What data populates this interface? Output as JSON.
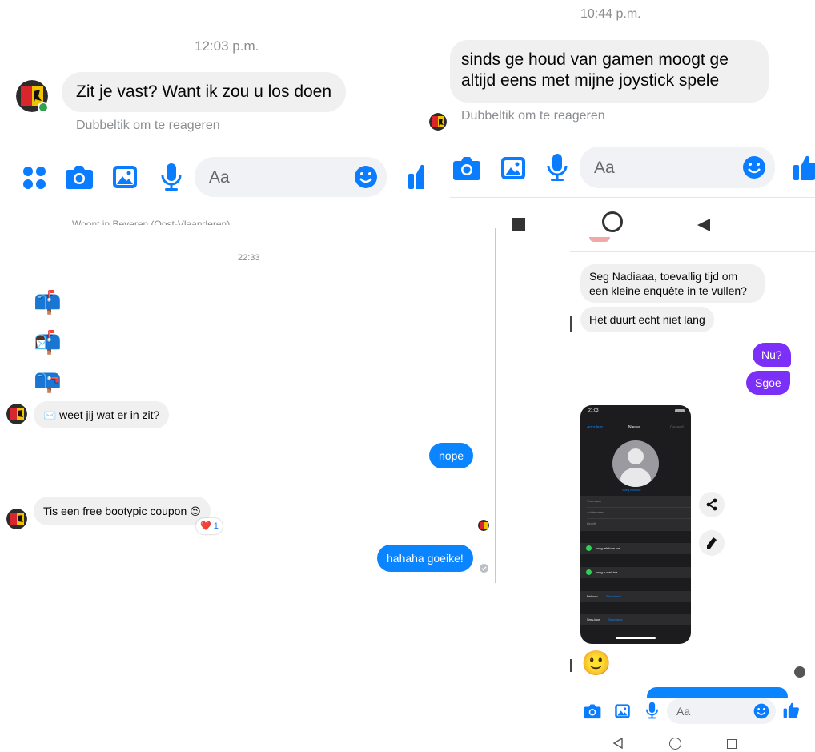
{
  "colors": {
    "messenger_blue": "#0a84ff",
    "purple": "#7b2ff7",
    "bubble_gray": "#f0f0f0",
    "icon_blue": "#0a7cff",
    "online_green": "#31a24c"
  },
  "panel_top_left": {
    "timestamp": "12:03 p.m.",
    "message": "Zit je vast? Want ik zou u los doen",
    "hint": "Dubbeltik om te reageren",
    "composer_placeholder": "Aa",
    "icons": [
      "grid-icon",
      "camera-icon",
      "image-icon",
      "microphone-icon",
      "emoji-icon",
      "thumbs-up-icon"
    ]
  },
  "panel_top_right": {
    "timestamp": "10:44 p.m.",
    "message_line1": "sinds ge houd van gamen moogt ge",
    "message_line2": "altijd eens met mijne joystick spele",
    "hint": "Dubbeltik om te reageren",
    "composer_placeholder": "Aa",
    "icons": [
      "camera-icon",
      "image-icon",
      "microphone-icon",
      "emoji-icon",
      "thumbs-up-icon"
    ]
  },
  "panel_bottom_left": {
    "header_cut_text": "Woont in Beveren (Oost-Vlaanderen)",
    "timestamp": "22:33",
    "mailbox_emojis": [
      "📫",
      "📬",
      "📪"
    ],
    "messages": [
      {
        "side": "in",
        "emoji": "✉️",
        "text": "weet jij wat er in zit?"
      },
      {
        "side": "out",
        "text": "nope"
      },
      {
        "side": "in",
        "text": "Tis een free bootypic coupon",
        "emoji": "😉",
        "reaction": "❤️",
        "reaction_count": "1"
      },
      {
        "side": "out",
        "text": "hahaha goeike!"
      }
    ]
  },
  "panel_bottom_right": {
    "messages": [
      {
        "side": "in",
        "line1": "Seg Nadiaaa, toevallig tijd om",
        "line2": "een kleine enquête in te vullen?"
      },
      {
        "side": "in",
        "text": "Het duurt echt niet lang"
      },
      {
        "side": "out",
        "text": "Nu?"
      },
      {
        "side": "out",
        "text": "Sgoe"
      }
    ],
    "shared_screenshot": {
      "status_time": "21:03",
      "cancel": "Annuleer",
      "title": "Nieuw",
      "done": "Gereed",
      "add_photo": "Voeg foto toe",
      "fields": [
        "Voornaam",
        "Achternaam",
        "Bedrijf"
      ],
      "add_phone": "voeg telefoon toe",
      "add_email": "voeg e-mail toe",
      "ringtone_label": "Beltoon",
      "ringtone_value": "Standaard",
      "sms_label": "Sms-toon",
      "sms_value": "Standaard"
    },
    "reaction_emoji": "🙂",
    "composer_placeholder": "Aa",
    "nav": [
      "back-nav-icon",
      "home-nav-icon",
      "recents-nav-icon"
    ]
  }
}
